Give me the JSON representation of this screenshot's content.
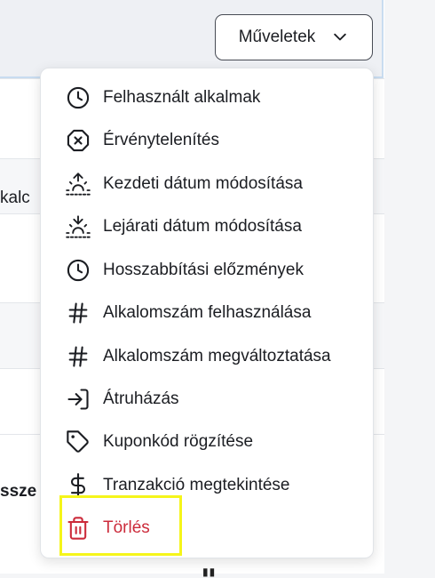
{
  "actions_button": {
    "label": "Műveletek"
  },
  "background": {
    "peek_texts": [
      "kalc",
      "ssze"
    ]
  },
  "menu": {
    "items": [
      {
        "label": "Felhasznált alkalmak",
        "icon": "clock-icon"
      },
      {
        "label": "Érvénytelenítés",
        "icon": "x-octagon-icon"
      },
      {
        "label": "Kezdeti dátum módosítása",
        "icon": "sunrise-icon"
      },
      {
        "label": "Lejárati dátum módosítása",
        "icon": "sunset-icon"
      },
      {
        "label": "Hosszabbítási előzmények",
        "icon": "clock-icon"
      },
      {
        "label": "Alkalomszám felhasználása",
        "icon": "hash-icon"
      },
      {
        "label": "Alkalomszám megváltoztatása",
        "icon": "hash-icon"
      },
      {
        "label": "Átruházás",
        "icon": "log-in-icon"
      },
      {
        "label": "Kuponkód rögzítése",
        "icon": "tag-icon"
      },
      {
        "label": "Tranzakció megtekintése",
        "icon": "dollar-icon"
      },
      {
        "label": "Törlés",
        "icon": "trash-icon",
        "danger": true
      }
    ]
  },
  "colors": {
    "danger": "#cc2b3b",
    "highlight": "#f5f51a",
    "header_border": "#c8dcf0"
  }
}
